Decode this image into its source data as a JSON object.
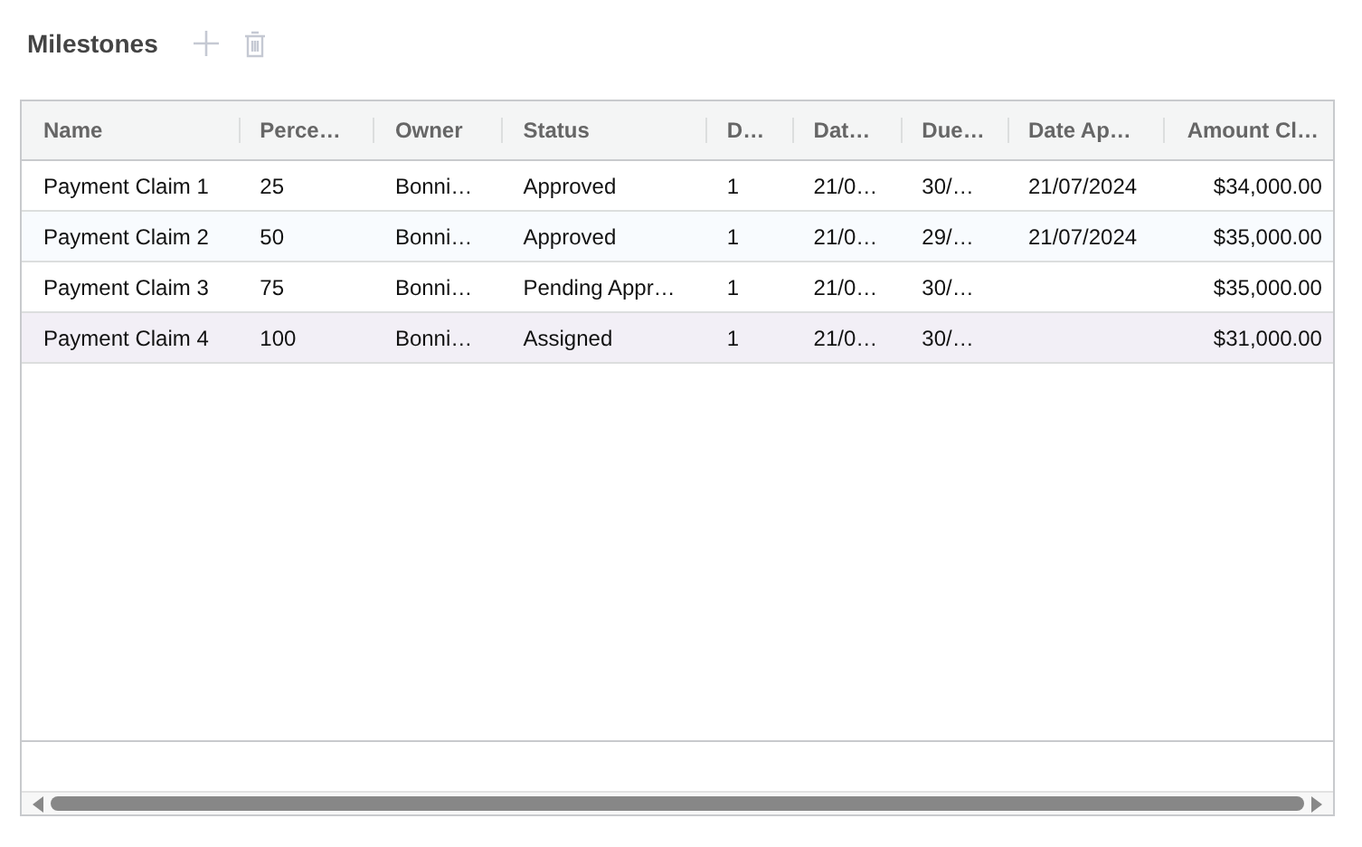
{
  "title": "Milestones",
  "table": {
    "columns": [
      {
        "label": "Name",
        "kind": "text"
      },
      {
        "label": "Perce…",
        "kind": "text"
      },
      {
        "label": "Owner",
        "kind": "text"
      },
      {
        "label": "Status",
        "kind": "text"
      },
      {
        "label": "D…",
        "kind": "text"
      },
      {
        "label": "Dat…",
        "kind": "text"
      },
      {
        "label": "Due…",
        "kind": "text"
      },
      {
        "label": "Date Ap…",
        "kind": "text"
      },
      {
        "label": "Amount Cl…",
        "kind": "currency"
      }
    ],
    "rows": [
      {
        "selected": false,
        "cells": [
          "Payment Claim 1",
          "25",
          "Bonni…",
          "Approved",
          "1",
          "21/0…",
          "30/…",
          "21/07/2024",
          "$34,000.00"
        ]
      },
      {
        "selected": false,
        "cells": [
          "Payment Claim 2",
          "50",
          "Bonni…",
          "Approved",
          "1",
          "21/0…",
          "29/…",
          "21/07/2024",
          "$35,000.00"
        ]
      },
      {
        "selected": false,
        "cells": [
          "Payment Claim 3",
          "75",
          "Bonni…",
          "Pending Appr…",
          "1",
          "21/0…",
          "30/…",
          "",
          "$35,000.00"
        ]
      },
      {
        "selected": true,
        "cells": [
          "Payment Claim 4",
          "100",
          "Bonni…",
          "Assigned",
          "1",
          "21/0…",
          "30/…",
          "",
          "$31,000.00"
        ]
      }
    ]
  }
}
